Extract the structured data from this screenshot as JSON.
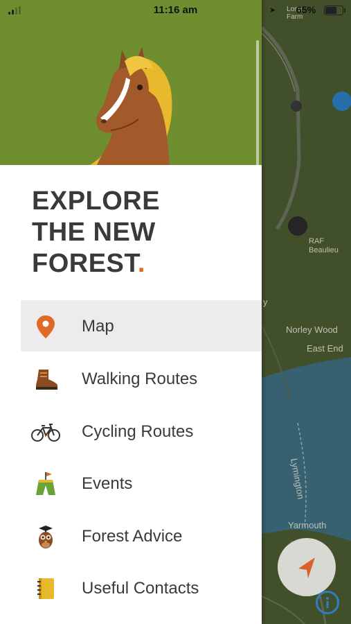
{
  "status_bar": {
    "time": "11:16 am",
    "battery_percent": "65%",
    "battery_level": 0.65
  },
  "map": {
    "labels": {
      "farm_top": "Long",
      "farm_bottom": "Farm",
      "raf_top": "RAF",
      "raf_bottom": "Beaulieu",
      "norley_wood": "Norley Wood",
      "east_end": "East End",
      "lymington": "Lymington",
      "yarmouth": "Yarmouth",
      "fragment_y": "y"
    },
    "colors": {
      "land": "#4c5b31",
      "water": "#3f6e80",
      "road": "#6a7560"
    }
  },
  "drawer": {
    "header_art_color": "#6e8e2f",
    "title_lines": [
      "EXPLORE",
      "THE NEW",
      "FOREST"
    ],
    "title_dot": ".",
    "accent_color": "#e06a25",
    "menu": [
      {
        "label": "Map",
        "icon": "map-pin-icon",
        "active": true
      },
      {
        "label": "Walking Routes",
        "icon": "hiking-boot-icon",
        "active": false
      },
      {
        "label": "Cycling Routes",
        "icon": "bicycle-icon",
        "active": false
      },
      {
        "label": "Events",
        "icon": "event-flag-icon",
        "active": false
      },
      {
        "label": "Forest Advice",
        "icon": "owl-icon",
        "active": false
      },
      {
        "label": "Useful Contacts",
        "icon": "notebook-icon",
        "active": false
      }
    ]
  },
  "buttons": {
    "navigate_icon": "navigation-arrow-icon",
    "info_icon": "info-icon"
  }
}
